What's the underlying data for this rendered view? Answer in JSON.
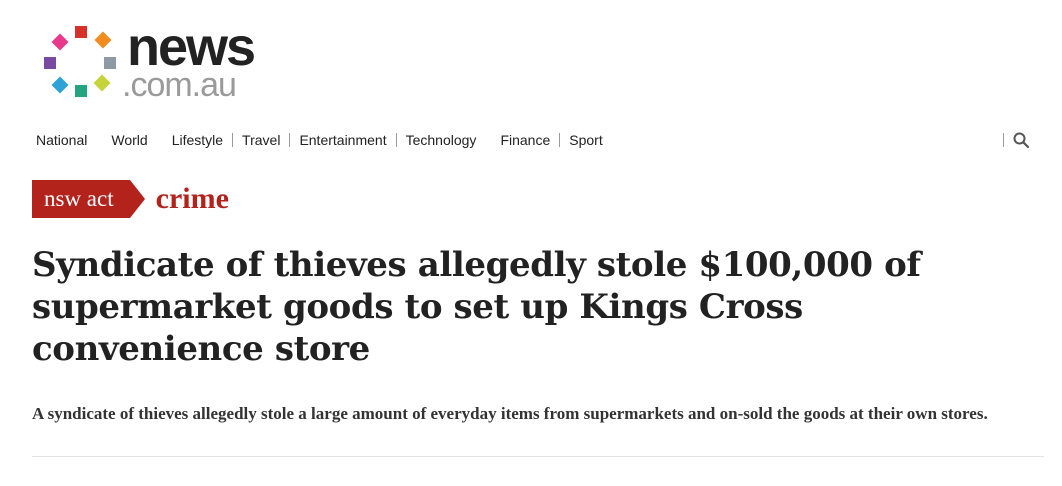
{
  "brand": {
    "word": "news",
    "domain": ".com.au",
    "dot_colors": [
      "#e8398c",
      "#d6312b",
      "#f28c1e",
      "#7a4aa0",
      "#8d9aa6",
      "#2ea3d8",
      "#25a57f",
      "#c6d43c"
    ]
  },
  "nav": {
    "items": [
      "National",
      "World",
      "Lifestyle",
      "Travel",
      "Entertainment",
      "Technology",
      "Finance",
      "Sport"
    ],
    "search_icon": "search-icon"
  },
  "section": {
    "state": "nsw act",
    "topic": "crime",
    "color": "#b4221c"
  },
  "article": {
    "headline": "Syndicate of thieves allegedly stole $100,000 of supermarket goods to set up Kings Cross convenience store",
    "standfirst": "A syndicate of thieves allegedly stole a large amount of everyday items from supermarkets and on-sold the goods at their own stores."
  }
}
